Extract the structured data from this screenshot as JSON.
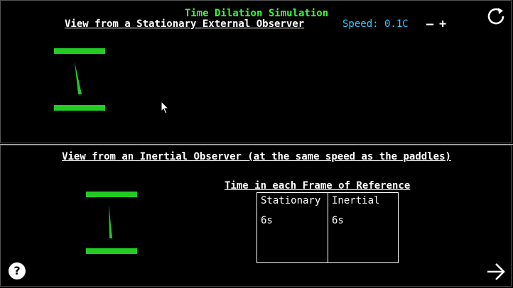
{
  "header": {
    "title": "Time Dilation Simulation",
    "top_view_label": "View from a Stationary External Observer",
    "speed_label": "Speed: 0.1C",
    "minus_label": "–",
    "plus_label": "+"
  },
  "bottom": {
    "view_label": "View from an Inertial Observer (at the same speed as the paddles)",
    "time_caption": "Time in each Frame of Reference",
    "table": {
      "columns": [
        {
          "header": "Stationary",
          "value": "6s"
        },
        {
          "header": "Inertial",
          "value": "6s"
        }
      ]
    }
  },
  "controls": {
    "help_label": "?"
  },
  "icons": {
    "reset": "reset-icon",
    "next": "arrow-right-icon",
    "help": "help-icon",
    "cursor": "cursor-icon"
  },
  "colors": {
    "accent_green": "#33ff33",
    "paddle_green": "#22cc22",
    "speed_cyan": "#33ccff",
    "background": "#000000"
  }
}
